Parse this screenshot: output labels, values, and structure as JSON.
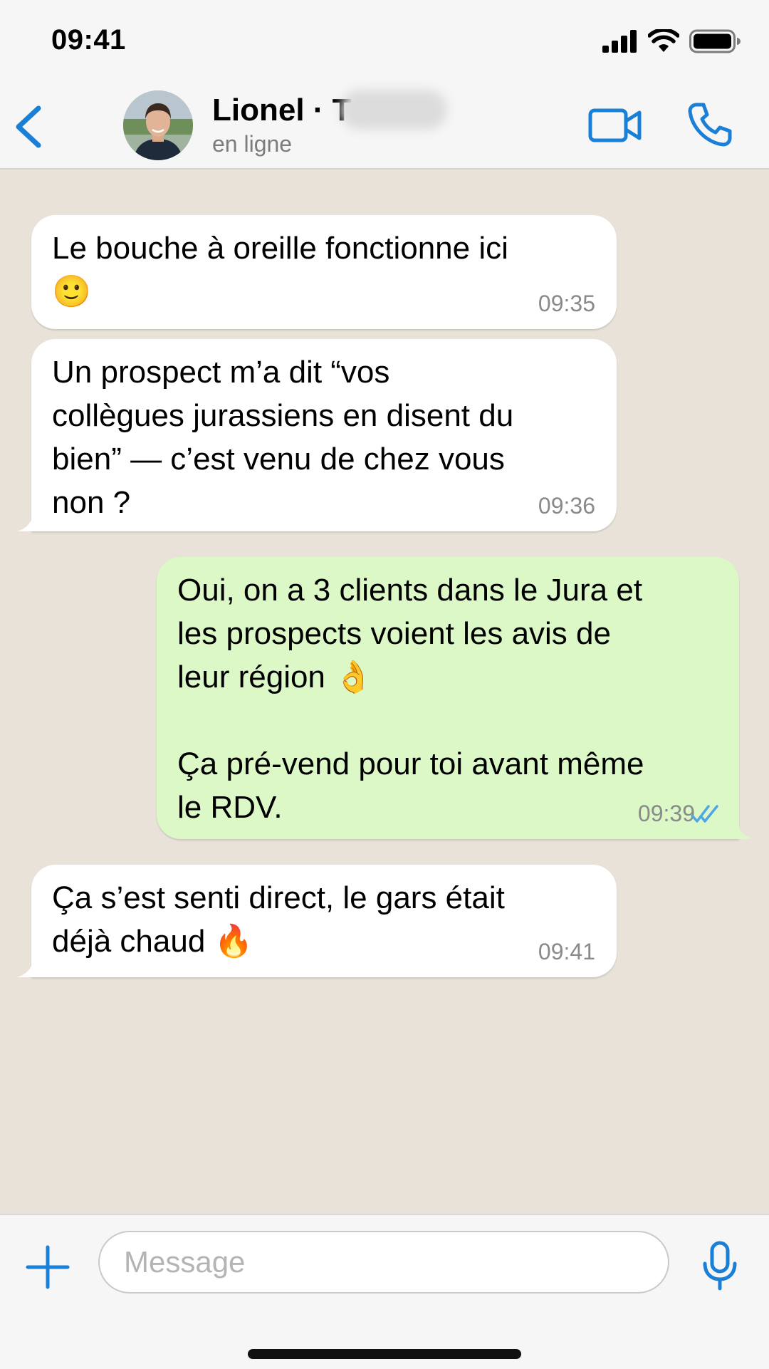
{
  "status_bar": {
    "time": "09:41"
  },
  "header": {
    "contact_name": "Lionel · T",
    "contact_status": "en ligne",
    "icons": [
      "back-chevron-icon",
      "video-camera-icon",
      "phone-icon"
    ]
  },
  "messages": [
    {
      "direction": "incoming",
      "text": "Le bouche à oreille fonctionne ici\n🙂",
      "time": "09:35"
    },
    {
      "direction": "incoming",
      "text": "Un prospect m’a dit “vos\ncollègues jurassiens en disent du\nbien” — c’est venu de chez vous\nnon ?",
      "time": "09:36"
    },
    {
      "direction": "outgoing",
      "text": "Oui, on a 3 clients dans le Jura et\nles prospects voient les avis de\nleur région 👌\n\nÇa pré-vend pour toi avant même\nle RDV.",
      "time": "09:39",
      "read": true
    },
    {
      "direction": "incoming",
      "text": "Ça s’est senti direct, le gars était\ndéjà chaud 🔥",
      "time": "09:41"
    }
  ],
  "input": {
    "placeholder": "Message"
  },
  "colors": {
    "accent": "#1a7fd6",
    "chat_background": "#e8e2d9",
    "incoming_bubble": "#ffffff",
    "outgoing_bubble": "#dcf8c6",
    "read_ticks": "#4fa6e6"
  }
}
